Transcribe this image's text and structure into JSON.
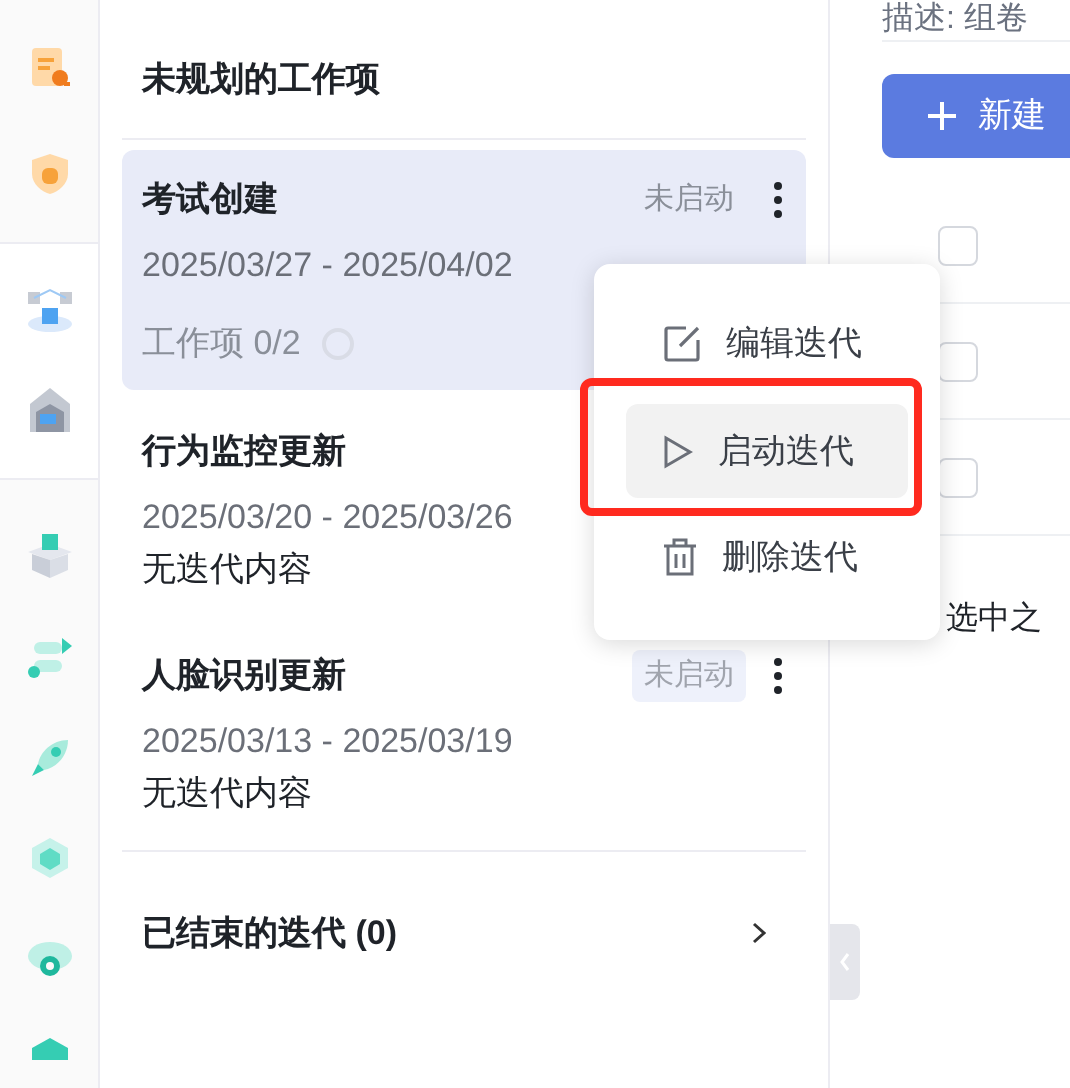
{
  "unplanned": {
    "title": "未规划的工作项",
    "iterations": [
      {
        "title": "考试创建",
        "selected": true,
        "status": {
          "label": "未启动",
          "filled": false
        },
        "menu": true,
        "dates": "2025/03/27 - 2025/04/02",
        "kind": "progress",
        "summary": "工作项 0/2"
      },
      {
        "title": "行为监控更新",
        "selected": false,
        "dates": "2025/03/20 - 2025/03/26",
        "kind": "empty",
        "summary": "无迭代内容"
      },
      {
        "title": "人脸识别更新",
        "selected": false,
        "status": {
          "label": "未启动",
          "filled": true
        },
        "menu": true,
        "dates": "2025/03/13 - 2025/03/19",
        "kind": "empty",
        "summary": "无迭代内容"
      }
    ]
  },
  "finished": {
    "label": "已结束的迭代 (0)"
  },
  "detail": {
    "description": "描述: 组卷",
    "new_button": "新建",
    "rows": [
      {
        "checked": false
      },
      {
        "checked": false
      },
      {
        "checked": false
      }
    ],
    "hint": "选中之"
  },
  "context_menu": [
    {
      "kind": "edit",
      "label": "编辑迭代",
      "selected": false
    },
    {
      "kind": "play",
      "label": "启动迭代",
      "selected": true
    },
    {
      "kind": "delete",
      "label": "删除迭代",
      "selected": false
    }
  ]
}
